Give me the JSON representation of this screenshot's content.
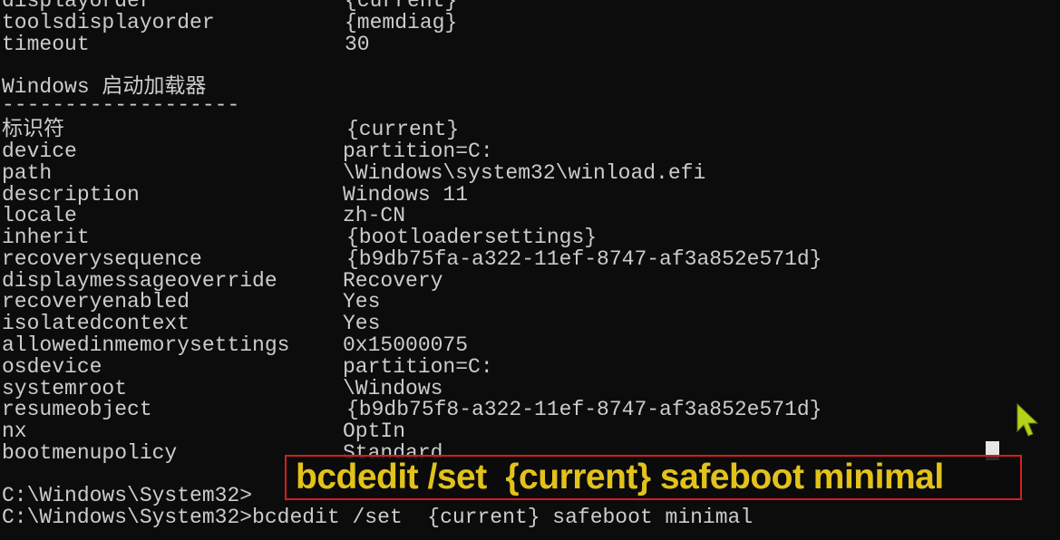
{
  "colors": {
    "terminal_bg": "#0c0c0c",
    "terminal_text": "#cccccc",
    "caption_text": "#e2c21b",
    "caption_border": "#d21f1f",
    "pointer": "#b5d21a"
  },
  "top_entries": [
    {
      "key": "displayorder",
      "value": "{current}"
    },
    {
      "key": "toolsdisplayorder",
      "value": "{memdiag}"
    },
    {
      "key": "timeout",
      "value": "30"
    }
  ],
  "section": {
    "heading": "Windows 启动加载器",
    "separator": "-------------------"
  },
  "entries": [
    {
      "key": "标识符",
      "value": "{current}"
    },
    {
      "key": "device",
      "value": "partition=C:"
    },
    {
      "key": "path",
      "value": "\\Windows\\system32\\winload.efi"
    },
    {
      "key": "description",
      "value": "Windows 11"
    },
    {
      "key": "locale",
      "value": "zh-CN"
    },
    {
      "key": "inherit",
      "value": "{bootloadersettings}"
    },
    {
      "key": "recoverysequence",
      "value": "{b9db75fa-a322-11ef-8747-af3a852e571d}"
    },
    {
      "key": "displaymessageoverride",
      "value": "Recovery"
    },
    {
      "key": "recoveryenabled",
      "value": "Yes"
    },
    {
      "key": "isolatedcontext",
      "value": "Yes"
    },
    {
      "key": "allowedinmemorysettings",
      "value": "0x15000075"
    },
    {
      "key": "osdevice",
      "value": "partition=C:"
    },
    {
      "key": "systemroot",
      "value": "\\Windows"
    },
    {
      "key": "resumeobject",
      "value": "{b9db75f8-a322-11ef-8747-af3a852e571d}"
    },
    {
      "key": "nx",
      "value": "OptIn"
    },
    {
      "key": "bootmenupolicy",
      "value": "Standard"
    }
  ],
  "prompts": {
    "line1": "C:\\Windows\\System32>",
    "line2": "C:\\Windows\\System32>bcdedit /set  {current} safeboot minimal"
  },
  "caption": {
    "text": "bcdedit /set  {current} safeboot minimal"
  },
  "icons": {
    "cursor": "text-cursor-block",
    "pointer": "mouse-pointer-icon"
  }
}
